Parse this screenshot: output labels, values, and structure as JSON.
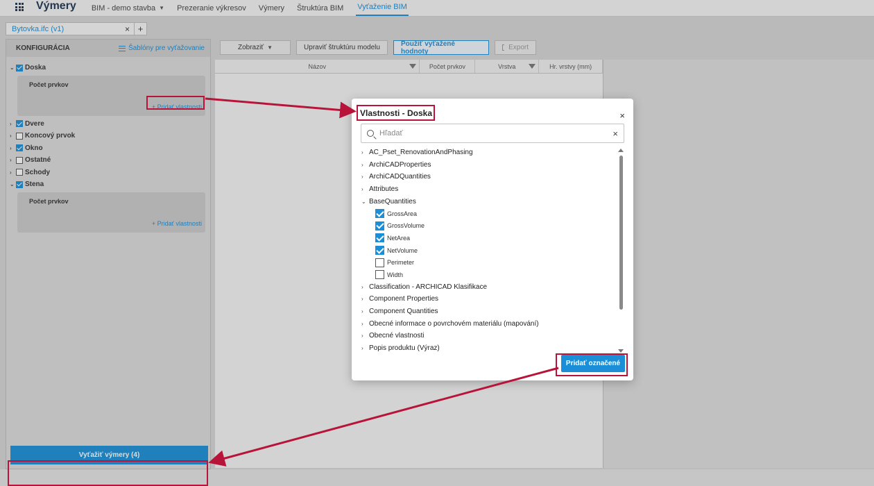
{
  "topnav": {
    "app_title": "Výmery",
    "items": [
      {
        "label": "BIM - demo stavba",
        "has_chevron": true
      },
      {
        "label": "Prezeranie výkresov"
      },
      {
        "label": "Výmery"
      },
      {
        "label": "Štruktúra BIM"
      },
      {
        "label": "Vyťaženie BIM",
        "active": true
      }
    ]
  },
  "file_tab": {
    "label": "Bytovka.ifc (v1)",
    "close": "×",
    "add": "+"
  },
  "left_panel": {
    "title": "KONFIGURÁCIA",
    "templates_label": "Šablóny pre vyťažovanie",
    "groups": [
      {
        "label": "Doska",
        "checked": true,
        "expanded": true,
        "count_label": "Počet prvkov",
        "add_label": "+ Pridať vlastnosti"
      },
      {
        "label": "Dvere",
        "checked": true,
        "expanded": false
      },
      {
        "label": "Koncový prvok",
        "checked": false,
        "expanded": false
      },
      {
        "label": "Okno",
        "checked": true,
        "expanded": false
      },
      {
        "label": "Ostatné",
        "checked": false,
        "expanded": false
      },
      {
        "label": "Schody",
        "checked": false,
        "expanded": false
      },
      {
        "label": "Stena",
        "checked": true,
        "expanded": true,
        "count_label": "Počet prvkov",
        "add_label": "+ Pridať vlastnosti"
      }
    ],
    "extract_button": "Vyťažiť výmery (4)"
  },
  "toolbar": {
    "show_label": "Zobraziť",
    "edit_label": "Upraviť štruktúru modelu",
    "use_label": "Použiť vyťažené hodnoty",
    "export_label": "Export"
  },
  "table": {
    "columns": [
      "Názov",
      "Počet prvkov",
      "Vrstva",
      "Hr. vrstvy (mm)"
    ]
  },
  "modal": {
    "title": "Vlastnosti - Doska",
    "close": "×",
    "search": {
      "placeholder": "Hľadať",
      "value": ""
    },
    "properties": [
      {
        "label": "AC_Pset_RenovationAndPhasing",
        "expanded": false
      },
      {
        "label": "ArchiCADProperties",
        "expanded": false
      },
      {
        "label": "ArchiCADQuantities",
        "expanded": false
      },
      {
        "label": "Attributes",
        "expanded": false
      },
      {
        "label": "BaseQuantities",
        "expanded": true,
        "children": [
          {
            "label": "GrossArea",
            "checked": true
          },
          {
            "label": "GrossVolume",
            "checked": true
          },
          {
            "label": "NetArea",
            "checked": true
          },
          {
            "label": "NetVolume",
            "checked": true
          },
          {
            "label": "Perimeter",
            "checked": false
          },
          {
            "label": "Width",
            "checked": false
          }
        ]
      },
      {
        "label": "Classification - ARCHICAD Klasifikace",
        "expanded": false
      },
      {
        "label": "Component Properties",
        "expanded": false
      },
      {
        "label": "Component Quantities",
        "expanded": false
      },
      {
        "label": "Obecné informace o povrchovém materiálu (mapování)",
        "expanded": false
      },
      {
        "label": "Obecné vlastnosti",
        "expanded": false
      },
      {
        "label": "Popis produktu (Výraz)",
        "expanded": false
      }
    ],
    "confirm_button": "Pridať označené"
  },
  "colors": {
    "accent": "#1a8fd8",
    "annotation": "#b8143a",
    "nav_title": "#1e3552"
  }
}
